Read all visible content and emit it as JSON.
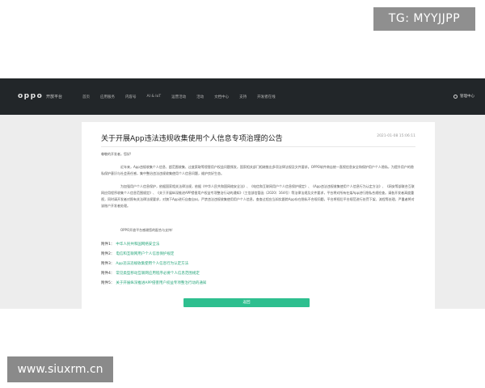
{
  "watermarks": {
    "top": "TG: MYYJJPP",
    "bottom": "www.siuxrm.cn"
  },
  "navbar": {
    "logo": "oppo",
    "logo_sub": "开放平台",
    "items": [
      "首页",
      "应用服务",
      "内容号",
      "AI & IoT",
      "运营活动",
      "活动",
      "文档中心",
      "支持",
      "开发者在线"
    ],
    "user": "管理中心"
  },
  "article": {
    "title": "关于开展App违法违规收集使用个人信息专项治理的公告",
    "date": "2021-01-08 15:06:11",
    "greeting": "尊敬的开发者，您好!",
    "paragraph1": "近年来，App违规收集个人信息、超范围收集、过度索取等侵害用户权益问题频发，国家相关部门相继推出多项法律法规及文件要求。OPPO软件商店统一直视信息安全和保护用户个人隐私，为提升用户的隐私保护意识与社会责任感，集中整治违法违规收集使用个人信息问题，维护良好生态。",
    "paragraph2": "为加强用户个人信息保护，依据国家相关法律法规，依据《中华人民共和国网络安全法》、《电信和互联网用户个人信息保护规定》、《App违法违规收集使用个人信息行为认定方法》、《网安等部联合互联网应用程序收集个人信息范围规定》、《关于开展纵深推进APP侵害用户权益专项整治行动的通知》（工信部信管函〔2020〕164号）等法律法规及文件要求，平台将对所有在架App进行隐私合规检查。请各开发者高度重视，同时请开发者对照有关法律法规要求，对旗下App进行自查自纠，严禁违法违规收集使用用户个人信息，查查过程应当如实跟踪App存在隐私不合规问题，平台将视后平台规范进行处罚下架、流程等处理，严重者将对该账户开发者处理。",
    "closing": "OPPO开放平台感谢您的配合与支持!",
    "attachments": [
      {
        "label": "附件1：",
        "text": "中华人民共和国网络安全法"
      },
      {
        "label": "附件2：",
        "text": "电信和互联网用户个人信息保护规定"
      },
      {
        "label": "附件3：",
        "text": "App违法违规收集使用个人信息行为认定方法"
      },
      {
        "label": "附件4：",
        "text": "常见类型移动互联网应用程序必要个人信息范围规定"
      },
      {
        "label": "附件5：",
        "text": "关于开展纵深推进APP侵害用户权益专项整治行动的通知"
      }
    ],
    "button": "返回"
  }
}
